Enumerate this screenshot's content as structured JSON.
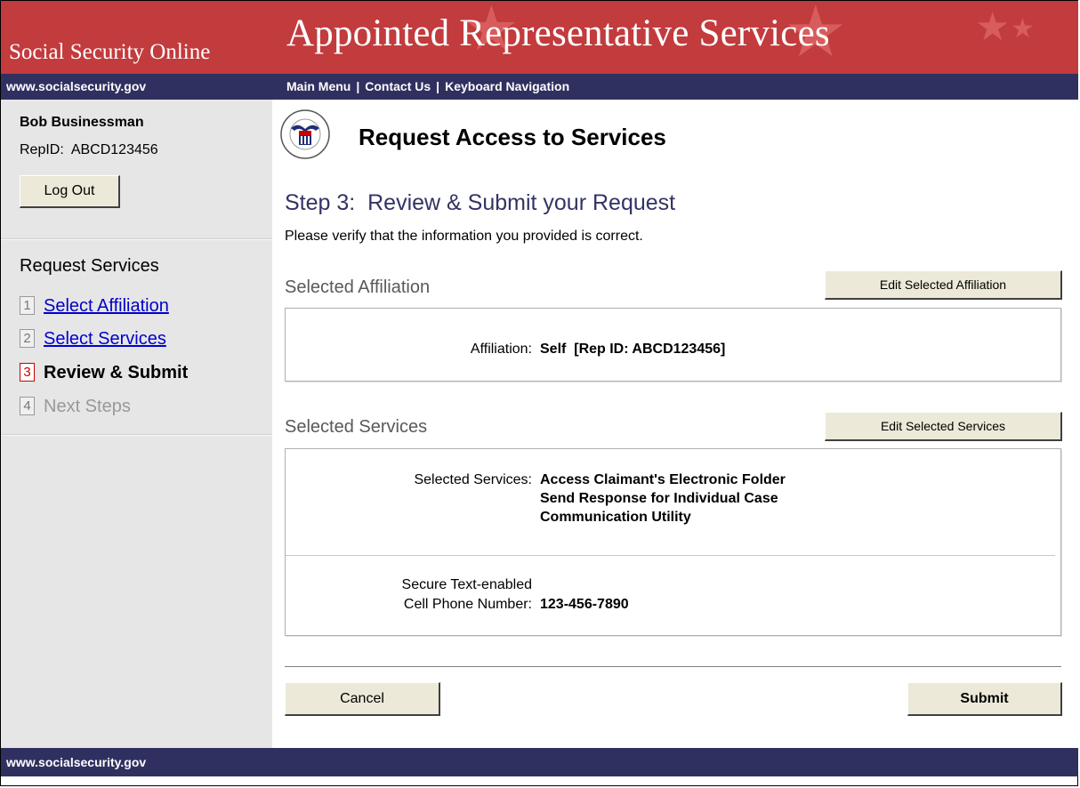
{
  "header": {
    "site_name": "Social Security Online",
    "app_title": "Appointed Representative Services"
  },
  "nav": {
    "site_link": "www.socialsecurity.gov",
    "main_menu": "Main Menu",
    "contact_us": "Contact Us",
    "keyboard_navigation": "Keyboard Navigation",
    "separator": "|"
  },
  "sidebar": {
    "user_name": "Bob Businessman",
    "rep_id_label": "RepID:",
    "rep_id_value": "ABCD123456",
    "logout_label": "Log Out",
    "section_title": "Request Services",
    "steps": [
      {
        "num": "1",
        "label": "Select Affiliation",
        "state": "link"
      },
      {
        "num": "2",
        "label": "Select Services",
        "state": "link"
      },
      {
        "num": "3",
        "label": "Review & Submit",
        "state": "current"
      },
      {
        "num": "4",
        "label": "Next Steps",
        "state": "disabled"
      }
    ]
  },
  "main": {
    "page_title": "Request Access to Services",
    "step_heading": "Step 3:  Review & Submit your Request",
    "step_description": "Please verify that the information you provided is correct.",
    "affiliation_section": {
      "title": "Selected Affiliation",
      "edit_label": "Edit Selected Affiliation",
      "field_label": "Affiliation:",
      "field_value": "Self  [Rep ID: ABCD123456]"
    },
    "services_section": {
      "title": "Selected Services",
      "edit_label": "Edit Selected Services",
      "services_label": "Selected Services:",
      "services": [
        "Access Claimant's Electronic Folder",
        "Send Response for Individual Case",
        "Communication Utility"
      ],
      "phone_label_line1": "Secure Text-enabled",
      "phone_label_line2": "Cell Phone Number:",
      "phone_value": "123-456-7890"
    },
    "cancel_label": "Cancel",
    "submit_label": "Submit"
  },
  "footer": {
    "site_link": "www.socialsecurity.gov"
  },
  "colors": {
    "banner_red": "#c23b3d",
    "nav_navy": "#303060",
    "step_heading": "#333366",
    "current_step_accent": "#cc0000",
    "link_blue": "#0000cc"
  }
}
